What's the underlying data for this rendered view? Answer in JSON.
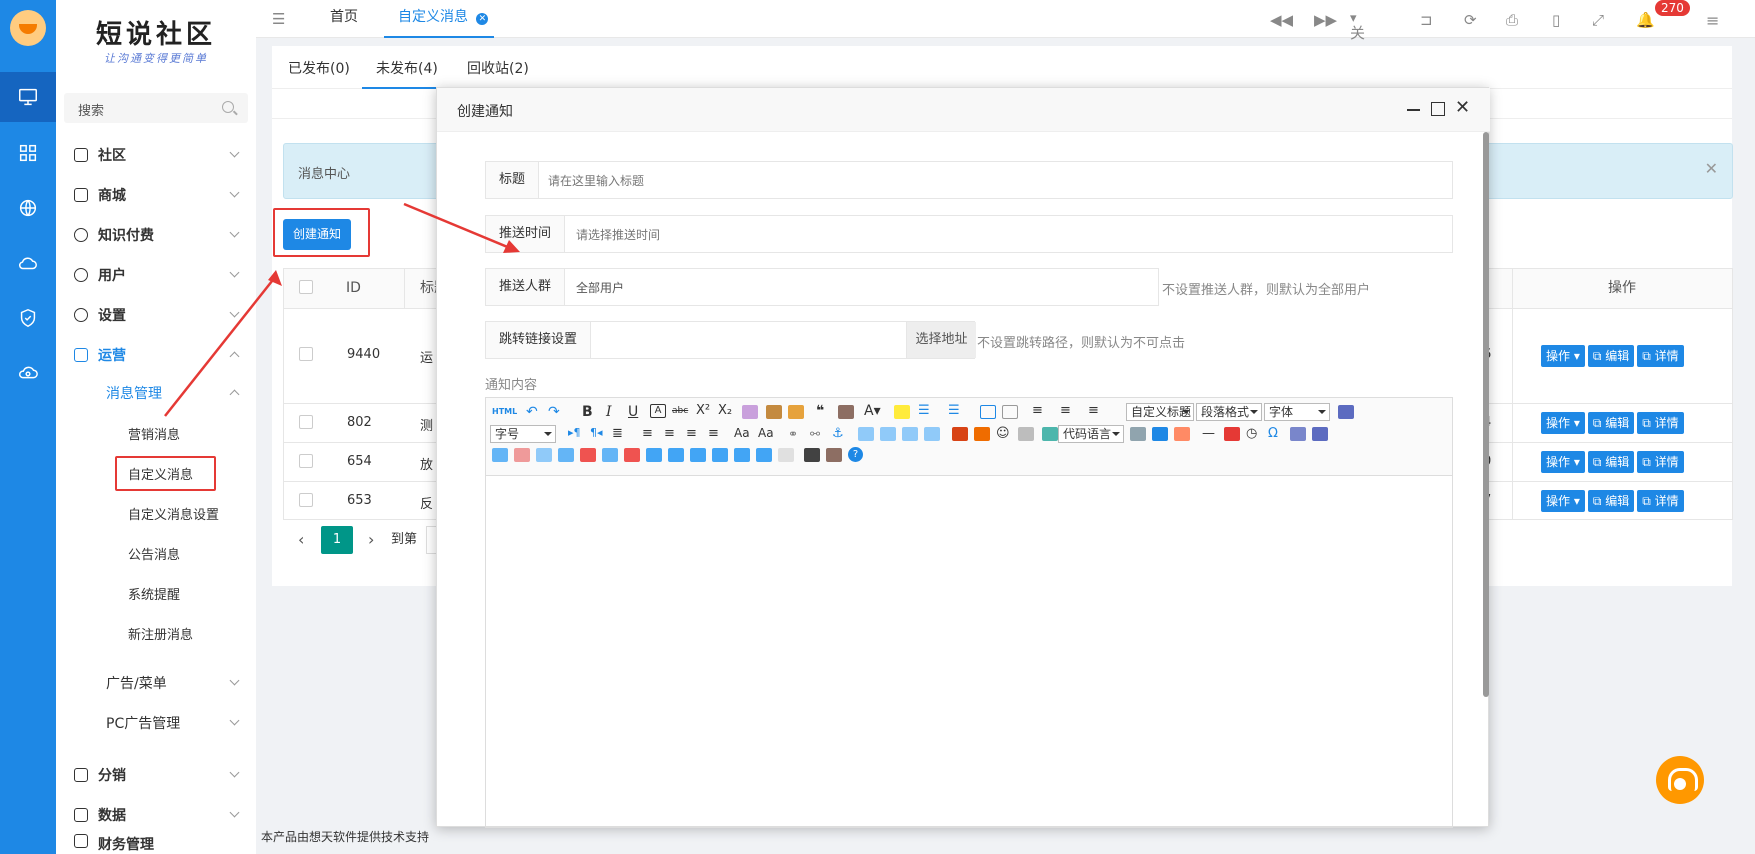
{
  "logo": {
    "title": "短说社区",
    "slogan": "让沟通变得更简单"
  },
  "search": {
    "placeholder": "搜索"
  },
  "menu": {
    "shequ": "社区",
    "shangcheng": "商城",
    "zhishi": "知识付费",
    "yonghu": "用户",
    "shezhi": "设置",
    "yunying": "运营",
    "xiaoxi": "消息管理",
    "sub": [
      "营销消息",
      "自定义消息",
      "自定义消息设置",
      "公告消息",
      "系统提醒",
      "新注册消息"
    ],
    "guanggao": "广告/菜单",
    "pcad": "PC广告管理",
    "fenxiao": "分销",
    "shuju": "数据",
    "caiwu": "财务管理"
  },
  "topbar": {
    "home_tab": "首页",
    "active_tab": "自定义消息",
    "close_label": "关闭",
    "badge": "270"
  },
  "subtabs": [
    "已发布(0)",
    "未发布(4)",
    "回收站(2)"
  ],
  "notice": {
    "text": "消息中心"
  },
  "create_button": "创建通知",
  "table": {
    "headers": {
      "id": "ID",
      "title": "标题",
      "ops": "操作"
    },
    "rows": [
      {
        "id": "9440",
        "title": "运",
        "tail": "6"
      },
      {
        "id": "802",
        "title": "测",
        "tail": "4"
      },
      {
        "id": "654",
        "title": "放",
        "tail": "0"
      },
      {
        "id": "653",
        "title": "反",
        "tail": "7"
      }
    ],
    "op_labels": {
      "op": "操作",
      "edit": "编辑",
      "detail": "详情"
    }
  },
  "pager": {
    "page": "1",
    "goto": "到第"
  },
  "footer": "本产品由想天软件提供技术支持",
  "modal": {
    "title": "创建通知",
    "fields": {
      "title_label": "标题",
      "title_placeholder": "请在这里输入标题",
      "time_label": "推送时间",
      "time_placeholder": "请选择推送时间",
      "crowd_label": "推送人群",
      "crowd_value": "全部用户",
      "crowd_hint": "不设置推送人群，则默认为全部用户",
      "link_label": "跳转链接设置",
      "link_button": "选择地址",
      "link_hint": "不设置跳转路径，则默认为不可点击",
      "content_label": "通知内容"
    },
    "editor": {
      "html_label": "HTML",
      "select_custom_title": "自定义标题",
      "select_paragraph": "段落格式",
      "select_font": "字体",
      "select_size": "字号",
      "select_code": "代码语言"
    }
  },
  "colors": {
    "primary": "#1e88e5",
    "danger": "#e53935",
    "pager": "#009688"
  }
}
